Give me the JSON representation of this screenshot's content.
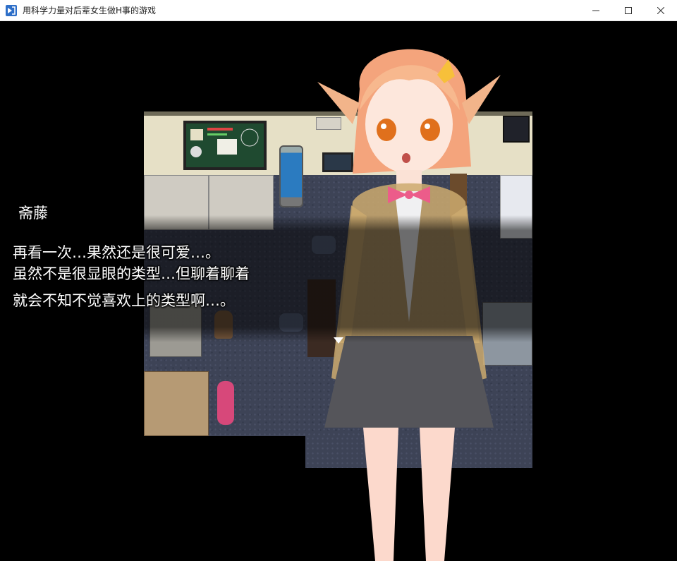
{
  "window": {
    "title": "用科学力量对后辈女生做H事的游戏",
    "icon": "app-icon",
    "controls": [
      "minimize-icon",
      "maximize-icon",
      "close-icon"
    ]
  },
  "dialogue": {
    "speaker": "斋藤",
    "lines": [
      "再看一次…果然还是很可爱…。",
      "虽然不是很显眼的类型…但聊着聊着",
      "就会不知不觉喜欢上的类型啊…。"
    ],
    "continue_indicator": "triangle-down-icon"
  },
  "colors": {
    "viewport_bg": "#000000",
    "text": "#ffffff",
    "floor": "#3d4356",
    "wall": "#e6e0c6"
  }
}
